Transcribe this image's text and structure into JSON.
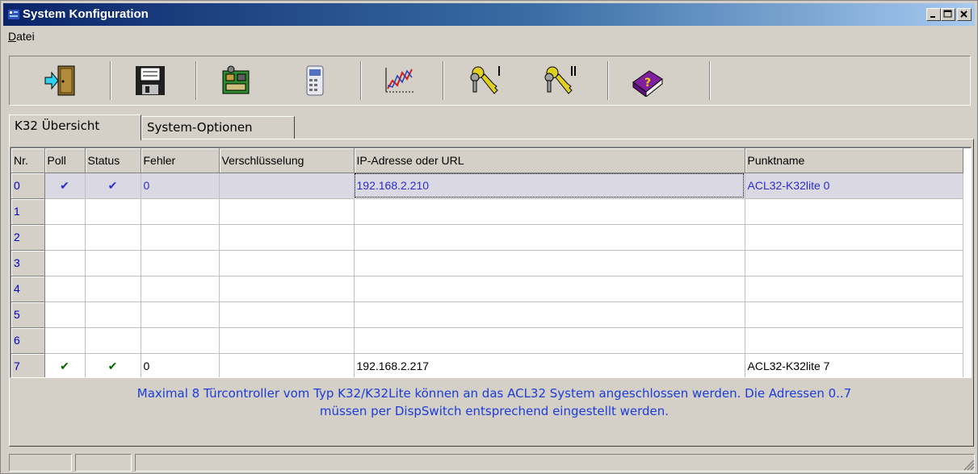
{
  "window": {
    "title": "System Konfiguration"
  },
  "menu": {
    "items": [
      {
        "accel": "D",
        "rest": "atei"
      }
    ]
  },
  "toolbar": {
    "buttons": [
      {
        "icon": "exit-door-icon"
      },
      {
        "icon": "save-disk-icon"
      },
      {
        "icon": "controller-board-icon"
      },
      {
        "icon": "device-terminal-icon"
      },
      {
        "icon": "chart-graph-icon"
      },
      {
        "icon": "keys-one-icon"
      },
      {
        "icon": "keys-two-icon"
      },
      {
        "icon": "help-book-icon"
      }
    ]
  },
  "tabs": [
    {
      "label": "K32 Übersicht",
      "active": true
    },
    {
      "label": "System-Optionen",
      "active": false
    }
  ],
  "grid": {
    "headers": [
      "Nr.",
      "Poll",
      "Status",
      "Fehler",
      "Verschlüsselung",
      "IP-Adresse oder URL",
      "Punktname"
    ],
    "rows": [
      {
        "nr": "0",
        "poll": "✔",
        "status": "✔",
        "fehler": "0",
        "encryption": "",
        "ip": "192.168.2.210",
        "name": "ACL32-K32lite 0",
        "selected": true
      },
      {
        "nr": "1",
        "poll": "",
        "status": "",
        "fehler": "",
        "encryption": "",
        "ip": "",
        "name": ""
      },
      {
        "nr": "2",
        "poll": "",
        "status": "",
        "fehler": "",
        "encryption": "",
        "ip": "",
        "name": ""
      },
      {
        "nr": "3",
        "poll": "",
        "status": "",
        "fehler": "",
        "encryption": "",
        "ip": "",
        "name": ""
      },
      {
        "nr": "4",
        "poll": "",
        "status": "",
        "fehler": "",
        "encryption": "",
        "ip": "",
        "name": ""
      },
      {
        "nr": "5",
        "poll": "",
        "status": "",
        "fehler": "",
        "encryption": "",
        "ip": "",
        "name": ""
      },
      {
        "nr": "6",
        "poll": "",
        "status": "",
        "fehler": "",
        "encryption": "",
        "ip": "",
        "name": ""
      },
      {
        "nr": "7",
        "poll": "✔",
        "status": "✔",
        "fehler": "0",
        "encryption": "",
        "ip": "192.168.2.217",
        "name": "ACL32-K32lite 7"
      }
    ]
  },
  "info": {
    "line1": "Maximal 8 Türcontroller vom Typ K32/K32Lite können an das ACL32 System angeschlossen werden. Die Adressen 0..7",
    "line2": "müssen per DispSwitch entsprechend eingestellt werden."
  },
  "colors": {
    "title_start": "#0a246a",
    "title_end": "#a6caf0",
    "info_text": "#1a3cd8",
    "check": "#006400"
  }
}
